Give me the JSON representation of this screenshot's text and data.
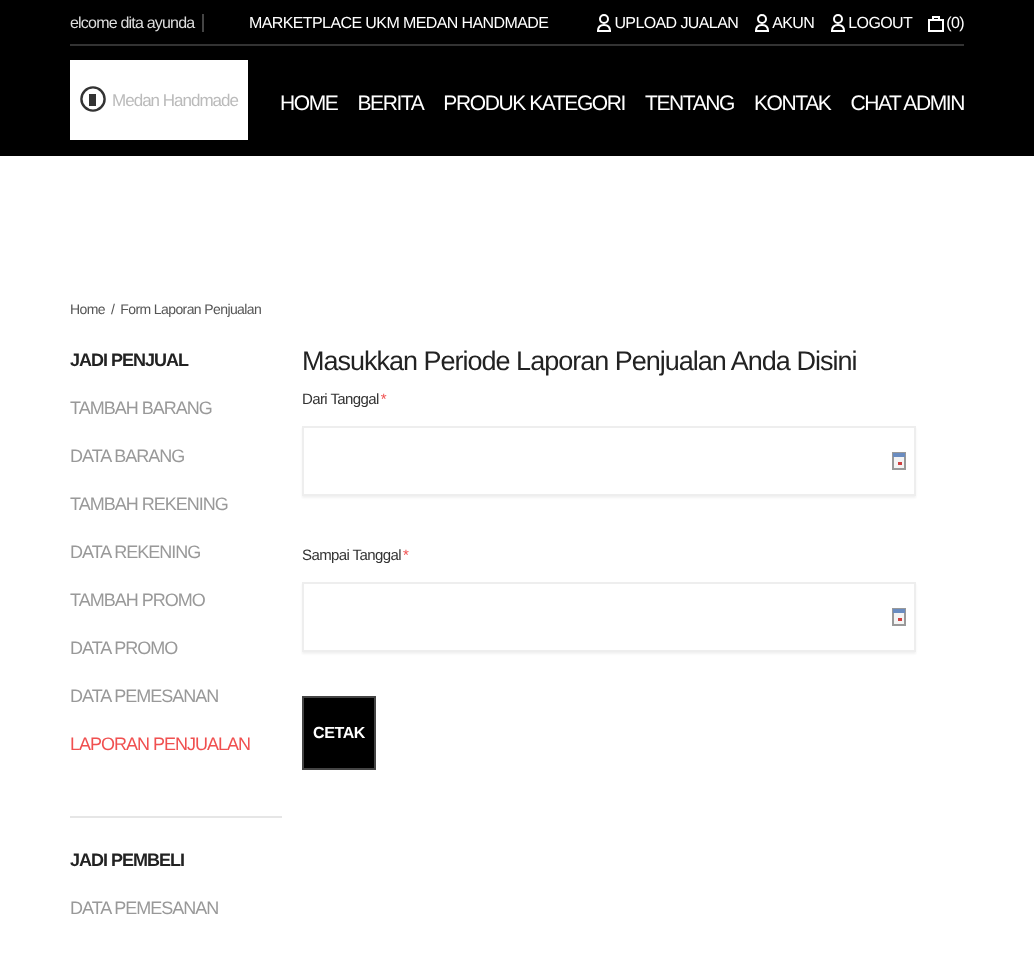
{
  "topbar": {
    "greeting": "elcome dita ayunda",
    "site_title": "MARKETPLACE UKM MEDAN HANDMADE",
    "links": [
      {
        "label": "UPLOAD JUALAN",
        "kind": "user"
      },
      {
        "label": "AKUN",
        "kind": "user"
      },
      {
        "label": "LOGOUT",
        "kind": "user"
      },
      {
        "label": "(0)",
        "kind": "bag"
      }
    ]
  },
  "logo": {
    "text": "Medan Handmade"
  },
  "nav": [
    "HOME",
    "BERITA",
    "PRODUK KATEGORI",
    "TENTANG",
    "KONTAK",
    "CHAT ADMIN"
  ],
  "breadcrumb": {
    "items": [
      "Home",
      "Form Laporan Penjualan"
    ],
    "separator": "/"
  },
  "sidebar": [
    {
      "heading": "JADI PENJUAL",
      "items": [
        {
          "label": "TAMBAH BARANG",
          "selected": false
        },
        {
          "label": "DATA BARANG",
          "selected": false
        },
        {
          "label": "TAMBAH REKENING",
          "selected": false
        },
        {
          "label": "DATA REKENING",
          "selected": false
        },
        {
          "label": "TAMBAH PROMO",
          "selected": false
        },
        {
          "label": "DATA PROMO",
          "selected": false
        },
        {
          "label": "DATA PEMESANAN",
          "selected": false
        },
        {
          "label": "LAPORAN PENJUALAN",
          "selected": true
        }
      ]
    },
    {
      "heading": "JADI PEMBELI",
      "items": [
        {
          "label": "DATA PEMESANAN",
          "selected": false
        }
      ]
    }
  ],
  "form": {
    "title": "Masukkan Periode Laporan Penjualan Anda Disini",
    "fields": [
      {
        "label": "Dari Tanggal",
        "required_mark": "*"
      },
      {
        "label": "Sampai Tanggal",
        "required_mark": "*"
      }
    ],
    "submit": "CETAK"
  }
}
